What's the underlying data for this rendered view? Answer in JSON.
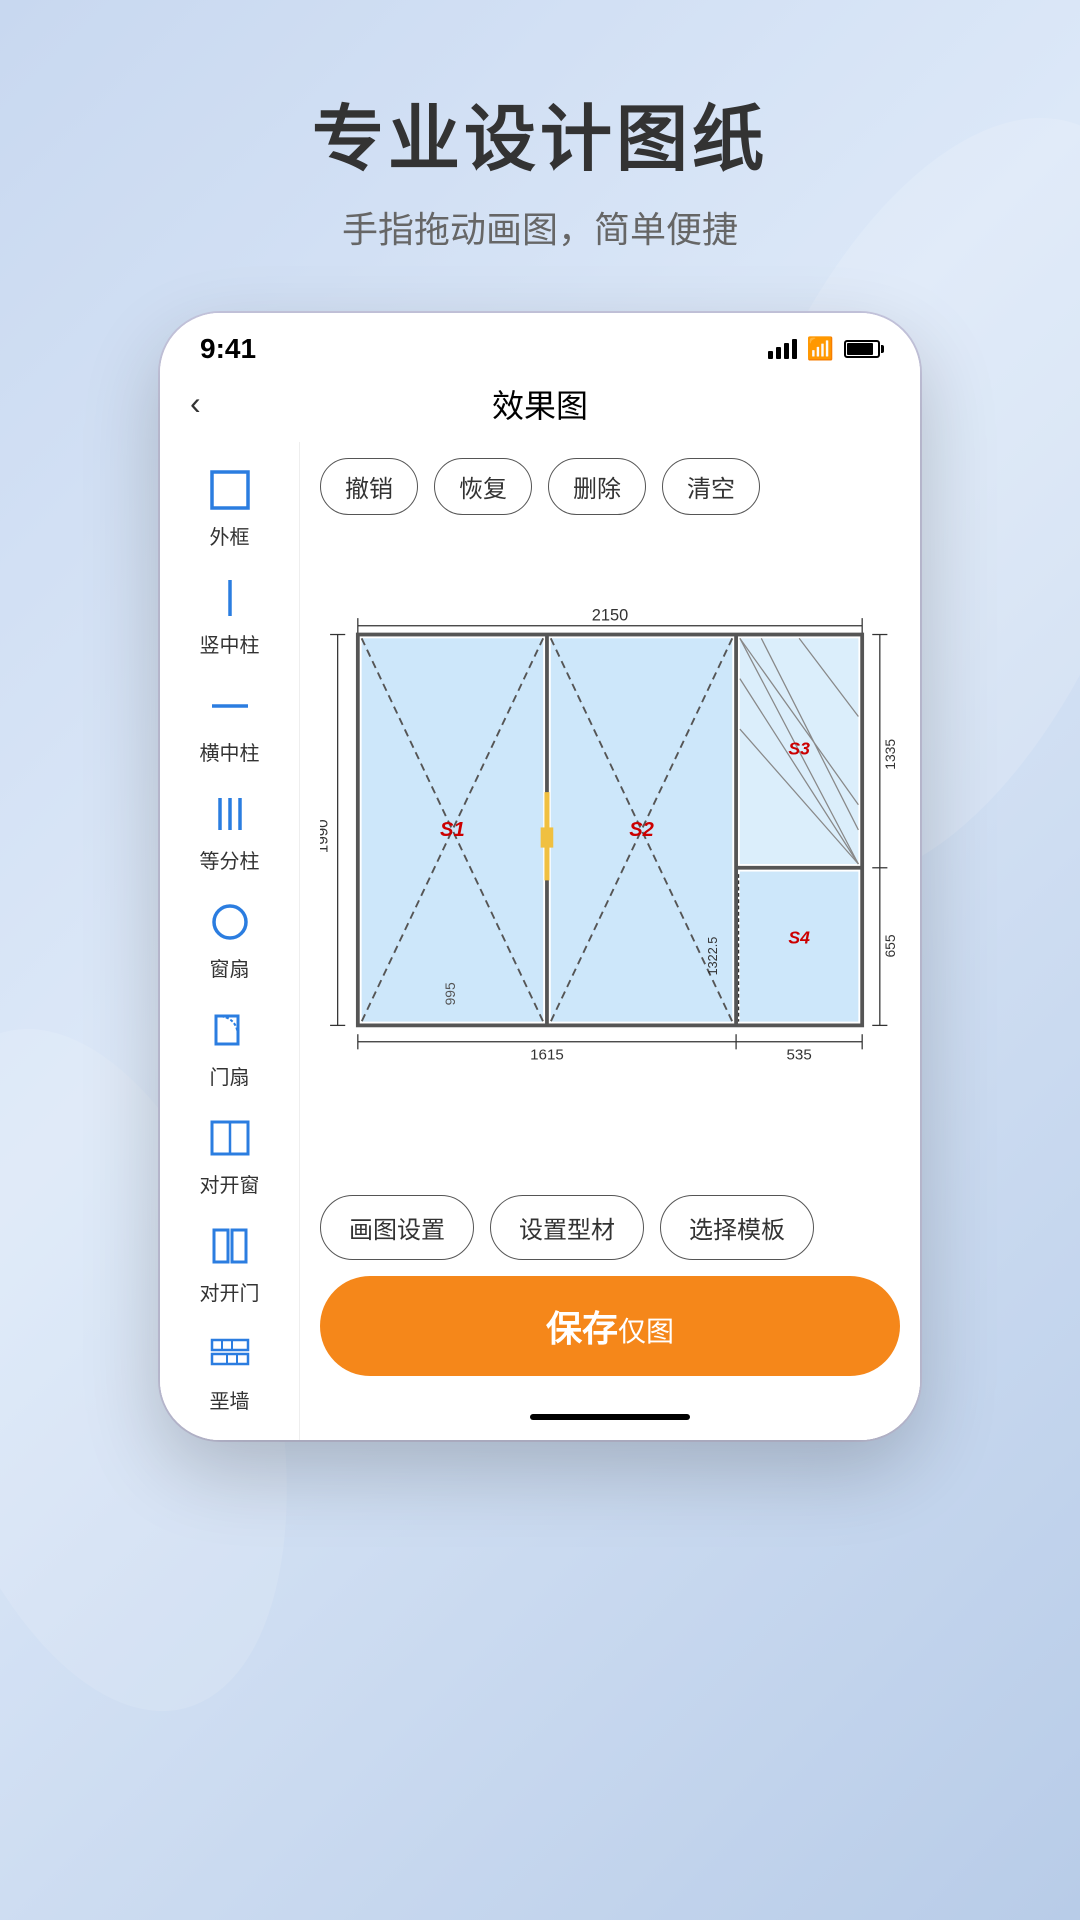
{
  "background": {
    "gradient_start": "#c8d8f0",
    "gradient_end": "#b8cce8"
  },
  "header": {
    "title": "专业设计图纸",
    "subtitle": "手指拖动画图，简单便捷"
  },
  "status_bar": {
    "time": "9:41",
    "signal_label": "signal",
    "wifi_label": "wifi",
    "battery_label": "battery"
  },
  "nav": {
    "back_icon": "‹",
    "title": "效果图"
  },
  "toolbar": {
    "undo": "撤销",
    "redo": "恢复",
    "delete": "删除",
    "clear": "清空"
  },
  "sidebar": {
    "items": [
      {
        "id": "outer-frame",
        "label": "外框",
        "icon": "square"
      },
      {
        "id": "vertical-pillar",
        "label": "竖中柱",
        "icon": "vline"
      },
      {
        "id": "horizontal-pillar",
        "label": "横中柱",
        "icon": "hline"
      },
      {
        "id": "equal-pillar",
        "label": "等分柱",
        "icon": "trilines"
      },
      {
        "id": "window-fan",
        "label": "窗扇",
        "icon": "circle"
      },
      {
        "id": "door-fan",
        "label": "门扇",
        "icon": "door-fan"
      },
      {
        "id": "double-window",
        "label": "对开窗",
        "icon": "double-window"
      },
      {
        "id": "double-door",
        "label": "对开门",
        "icon": "double-door"
      },
      {
        "id": "wall",
        "label": "垩墙",
        "icon": "wall"
      }
    ]
  },
  "canvas": {
    "dimensions": {
      "total_width": "2150",
      "left_width": "1615",
      "right_width": "535",
      "total_height": "1990",
      "right_height": "1335",
      "bottom_height": "655",
      "middle": "995",
      "inner_right": "1322.5",
      "label_s1": "S1",
      "label_s2": "S2",
      "label_s3": "S3"
    }
  },
  "bottom": {
    "settings_btn": "画图设置",
    "material_btn": "设置型材",
    "template_btn": "选择模板",
    "save_btn": "保存",
    "save_sub": "仅图"
  }
}
